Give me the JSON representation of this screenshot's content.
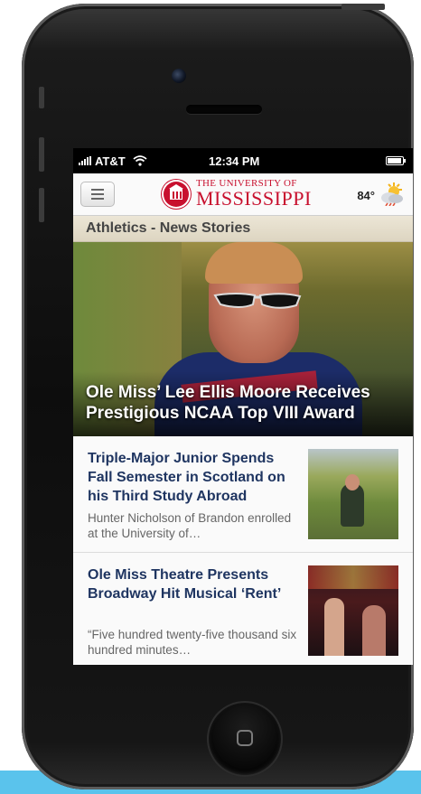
{
  "status_bar": {
    "carrier": "AT&T",
    "time": "12:34 PM"
  },
  "header": {
    "logo_top": "THE UNIVERSITY OF",
    "logo_main": "MISSISSIPPI",
    "temperature": "84°",
    "weather_icon": "partly-cloudy-icon"
  },
  "section_title": "Athletics - News Stories",
  "hero": {
    "title": "Ole Miss’ Lee Ellis Moore Receives Prestigious NCAA Top VIII Award"
  },
  "news": [
    {
      "title": "Triple-Major Junior Spends Fall Semester in Scotland on his Third Study Abroad",
      "summary": "Hunter Nicholson of Brandon enrolled at the University of…"
    },
    {
      "title": "Ole Miss Theatre Presents Broadway Hit Musical ‘Rent’",
      "summary": "“Five hundred twenty-five thousand six hundred minutes…"
    }
  ],
  "colors": {
    "brand_red": "#c8102e",
    "headline_navy": "#1f3561",
    "accent_blue": "#5ac3ec"
  }
}
